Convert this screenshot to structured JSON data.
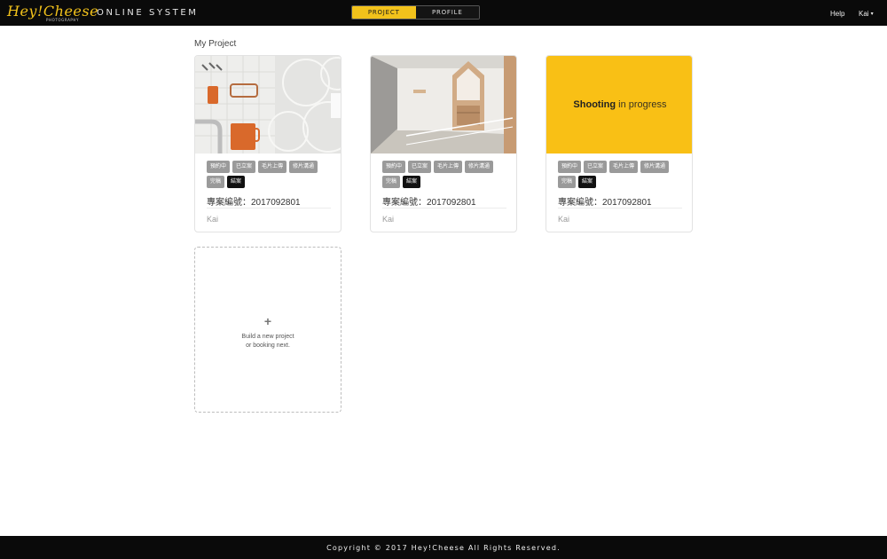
{
  "header": {
    "logo_text": "Hey!Cheese",
    "logo_subtext": "PHOTOGRAPHY",
    "system_title": "ONLINE SYSTEM",
    "tabs": [
      {
        "label": "PROJECT",
        "active": true
      },
      {
        "label": "PROFILE",
        "active": false
      }
    ],
    "help_label": "Help",
    "user_label": "Kai",
    "user_caret": "▾"
  },
  "main": {
    "section_title": "My Project",
    "projects": [
      {
        "image": "kitchen-tools-photo",
        "tags_row1": [
          "預約中",
          "已立案",
          "毛片上傳"
        ],
        "tags_row2": [
          "修片溝通",
          "完稿",
          "結案"
        ],
        "project_no": "專案編號：2017092801",
        "owner": "Kai"
      },
      {
        "image": "house-interior-photo",
        "tags_row1": [
          "預約中",
          "已立案",
          "毛片上傳"
        ],
        "tags_row2": [
          "修片溝通",
          "完稿",
          "結案"
        ],
        "project_no": "專案編號：2017092801",
        "owner": "Kai"
      },
      {
        "image": "shooting-placeholder",
        "status_bold": "Shooting",
        "status_rest": " in progress",
        "tags_row1": [
          "預約中",
          "已立案",
          "毛片上傳"
        ],
        "tags_row2": [
          "修片溝通",
          "完稿",
          "結案"
        ],
        "project_no": "專案編號：2017092801",
        "owner": "Kai"
      }
    ],
    "new_project": {
      "plus": "+",
      "line1": "Build a new project",
      "line2": "or booking next."
    }
  },
  "footer": {
    "copyright": "Copyright © 2017 Hey!Cheese All Rights Reserved."
  },
  "colors": {
    "accent": "#f2c21b",
    "shooting_bg": "#f9c015",
    "bar_bg": "#0a0a0a",
    "tag_grey": "#9a9a9a",
    "tag_dark": "#111111"
  }
}
